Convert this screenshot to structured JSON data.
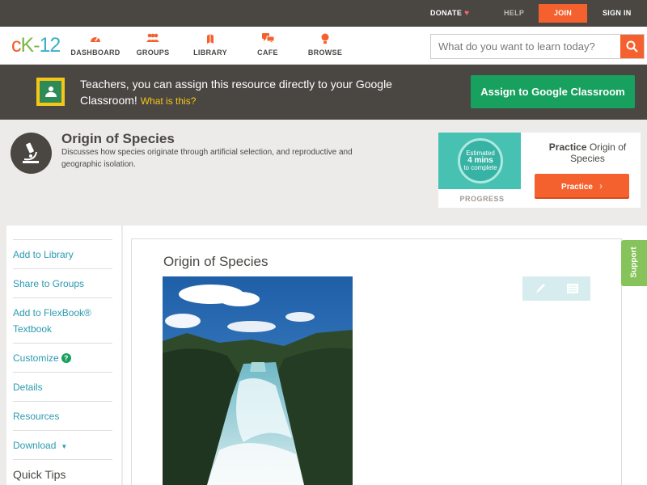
{
  "topbar": {
    "donate": "DONATE",
    "help": "HELP",
    "join": "JOIN",
    "signin": "SIGN IN"
  },
  "logo": {
    "text_c": "c",
    "text_k": "K",
    "text_dash": "-",
    "text_num": "12"
  },
  "nav": {
    "items": [
      {
        "label": "DASHBOARD",
        "icon": "dashboard-icon"
      },
      {
        "label": "GROUPS",
        "icon": "groups-icon"
      },
      {
        "label": "LIBRARY",
        "icon": "library-icon"
      },
      {
        "label": "CAFE",
        "icon": "cafe-icon"
      },
      {
        "label": "BROWSE",
        "icon": "browse-icon"
      }
    ],
    "search_placeholder": "What do you want to learn today?"
  },
  "banner": {
    "text": "Teachers, you can assign this resource directly to your Google Classroom!",
    "what_link": "What is this?",
    "assign_button": "Assign to Google Classroom"
  },
  "header": {
    "title": "Origin of Species",
    "description": "Discusses how species originate through artificial selection, and reproductive and geographic isolation."
  },
  "practice": {
    "estimated_line1": "Estimated",
    "estimated_mins": "4 mins",
    "estimated_line3": "to complete",
    "progress_label": "PROGRESS",
    "title_bold": "Practice",
    "title_rest": "Origin of Species",
    "button": "Practice"
  },
  "sidebar": {
    "items": [
      {
        "label": "Add to Library"
      },
      {
        "label": "Share to Groups"
      },
      {
        "label": "Add to FlexBook® Textbook"
      },
      {
        "label": "Customize"
      },
      {
        "label": "Details"
      },
      {
        "label": "Resources"
      },
      {
        "label": "Download"
      }
    ],
    "quick_tips": "Quick Tips"
  },
  "main": {
    "title": "Origin of Species"
  },
  "support": "Support",
  "colors": {
    "brand_orange": "#f5612e",
    "dark": "#4a4743",
    "green": "#18a05e",
    "link": "#2a9ab0"
  }
}
